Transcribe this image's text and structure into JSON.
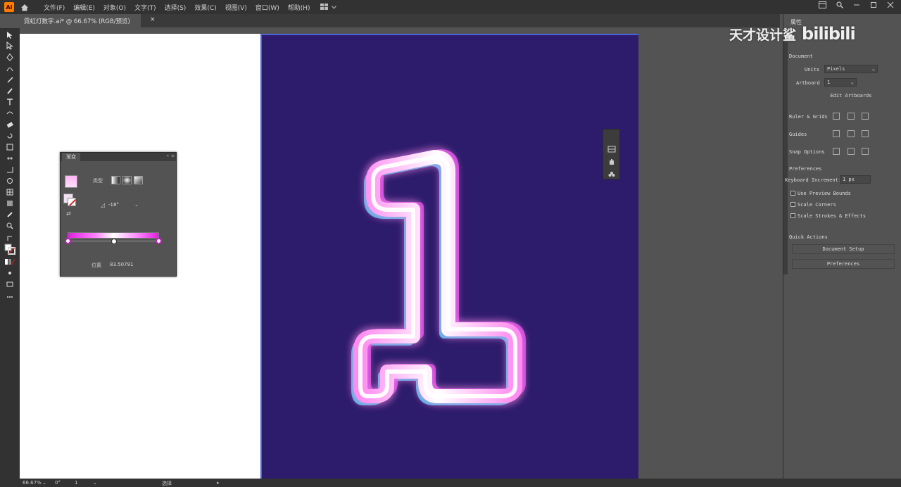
{
  "app": {
    "logo_text": "Ai",
    "menu": [
      "文件(F)",
      "编辑(E)",
      "对象(O)",
      "文字(T)",
      "选择(S)",
      "效果(C)",
      "视图(V)",
      "窗口(W)",
      "帮助(H)"
    ]
  },
  "document_tab": {
    "title": "霓虹灯数字.ai* @ 66.67% (RGB/预览)"
  },
  "gradient_panel": {
    "tab_label": "渐变",
    "type_label": "类型",
    "angle_value": "-18°",
    "opacity_label": "位置",
    "opacity_value": "83.50791"
  },
  "properties_panel": {
    "tab_label": "属性",
    "section_document": "Document",
    "units_label": "Units",
    "units_value": "Pixels",
    "artboards_label": "Artboard",
    "artboards_value": "1",
    "edit_artboards": "Edit Artboards",
    "ruler_grids": "Ruler & Grids",
    "guides": "Guides",
    "snap_options": "Snap Options",
    "preferences_header": "Preferences",
    "keyboard_increment_label": "Keyboard Increment:",
    "keyboard_increment_value": "1 px",
    "use_preview_bounds": "Use Preview Bounds",
    "scale_corners": "Scale Corners",
    "scale_strokes": "Scale Strokes & Effects",
    "quick_actions": "Quick Actions",
    "document_setup": "Document Setup",
    "preferences_button": "Preferences"
  },
  "watermark": {
    "text": "天才设计鲨",
    "logo": "bilibili"
  },
  "statusbar": {
    "zoom": "66.67%",
    "rotation": "0°",
    "artboard_num": "1",
    "tool_name": "选择"
  },
  "colors": {
    "artboard_bg": "#2d1b6b",
    "neon_pink": "#ff8cf0",
    "neon_cyan": "#3ed7f5",
    "panel_bg": "#535353",
    "chrome_bg": "#323232"
  }
}
